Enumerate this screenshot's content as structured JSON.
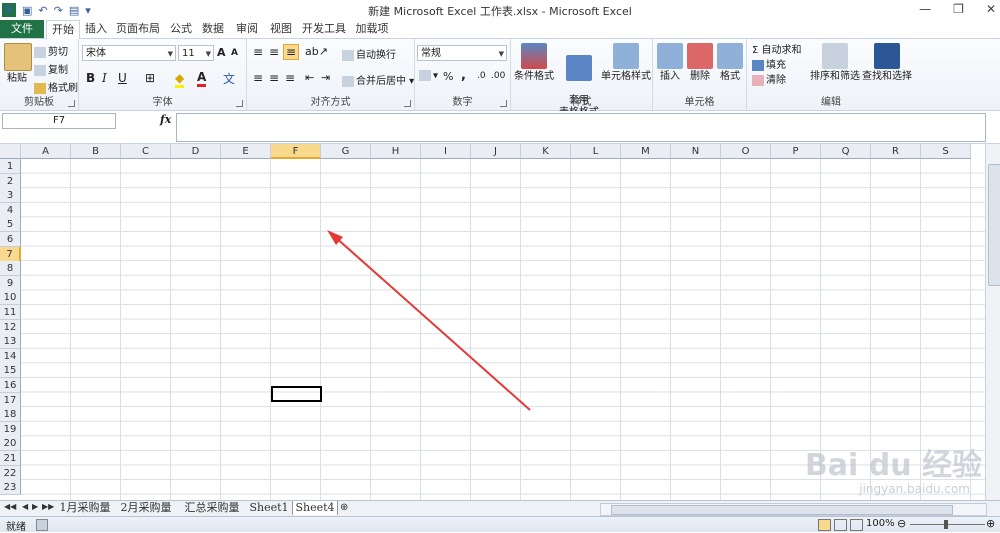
{
  "window": {
    "title": "新建 Microsoft Excel 工作表.xlsx - Microsoft Excel",
    "minimize": "—",
    "restore": "❐",
    "close": "✕"
  },
  "tabs": [
    {
      "label": "文件"
    },
    {
      "label": "开始"
    },
    {
      "label": "插入"
    },
    {
      "label": "页面布局"
    },
    {
      "label": "公式"
    },
    {
      "label": "数据"
    },
    {
      "label": "审阅"
    },
    {
      "label": "视图"
    },
    {
      "label": "开发工具"
    },
    {
      "label": "加载项"
    }
  ],
  "ribbon": {
    "clipboard": {
      "label": "剪贴板",
      "paste": "粘贴",
      "cut": "剪切",
      "copy": "复制",
      "format_painter": "格式刷"
    },
    "font": {
      "label": "字体",
      "font_name": "宋体",
      "font_size": "11",
      "bold": "B",
      "italic": "I",
      "underline": "U",
      "grow": "A",
      "shrink": "A",
      "border_icon": "⊞",
      "fill_icon": "◆",
      "color_letter": "A",
      "phonetic": "文"
    },
    "alignment": {
      "label": "对齐方式",
      "wrap": "自动换行",
      "merge": "合并后居中"
    },
    "number": {
      "label": "数字",
      "format": "常规",
      "percent": "%",
      "comma": ",",
      "inc_decimal": ".0",
      "dec_decimal": ".00"
    },
    "styles": {
      "label": "样式",
      "cond_format": "条件格式",
      "table_format": "套用\n表格格式",
      "cell_style": "单元格样式"
    },
    "cells": {
      "label": "单元格",
      "insert": "插入",
      "delete": "删除",
      "format": "格式"
    },
    "editing": {
      "label": "编辑",
      "autosum": "Σ 自动求和",
      "fill": "填充",
      "clear": "清除",
      "sort_filter": "排序和筛选",
      "find_select": "查找和选择"
    }
  },
  "formula_bar": {
    "name_box": "F7",
    "fx": "fx",
    "value": ""
  },
  "columns": [
    "A",
    "B",
    "C",
    "D",
    "E",
    "F",
    "G",
    "H",
    "I",
    "J",
    "K",
    "L",
    "M",
    "N",
    "O",
    "P",
    "Q",
    "R",
    "S"
  ],
  "rows": [
    "1",
    "2",
    "3",
    "4",
    "5",
    "6",
    "7",
    "8",
    "9",
    "10",
    "11",
    "12",
    "13",
    "14",
    "15",
    "16",
    "17",
    "18",
    "19",
    "20",
    "21",
    "22",
    "23"
  ],
  "selected_cell": {
    "column": "F",
    "row": "7"
  },
  "sheets": [
    {
      "name": "1月采购量"
    },
    {
      "name": "2月采购量"
    },
    {
      "name": "汇总采购量"
    },
    {
      "name": "Sheet1"
    },
    {
      "name": "Sheet4"
    }
  ],
  "active_sheet": "Sheet4",
  "status": {
    "ready": "就绪",
    "zoom": "100%",
    "zoom_minus": "⊖",
    "zoom_plus": "⊕"
  },
  "watermark": {
    "brand": "Bai du 经验",
    "url": "jingyan.baidu.com"
  },
  "colors": {
    "file_tab": "#217346",
    "selected_header": "#f9d98e",
    "arrow": "#e53935"
  }
}
